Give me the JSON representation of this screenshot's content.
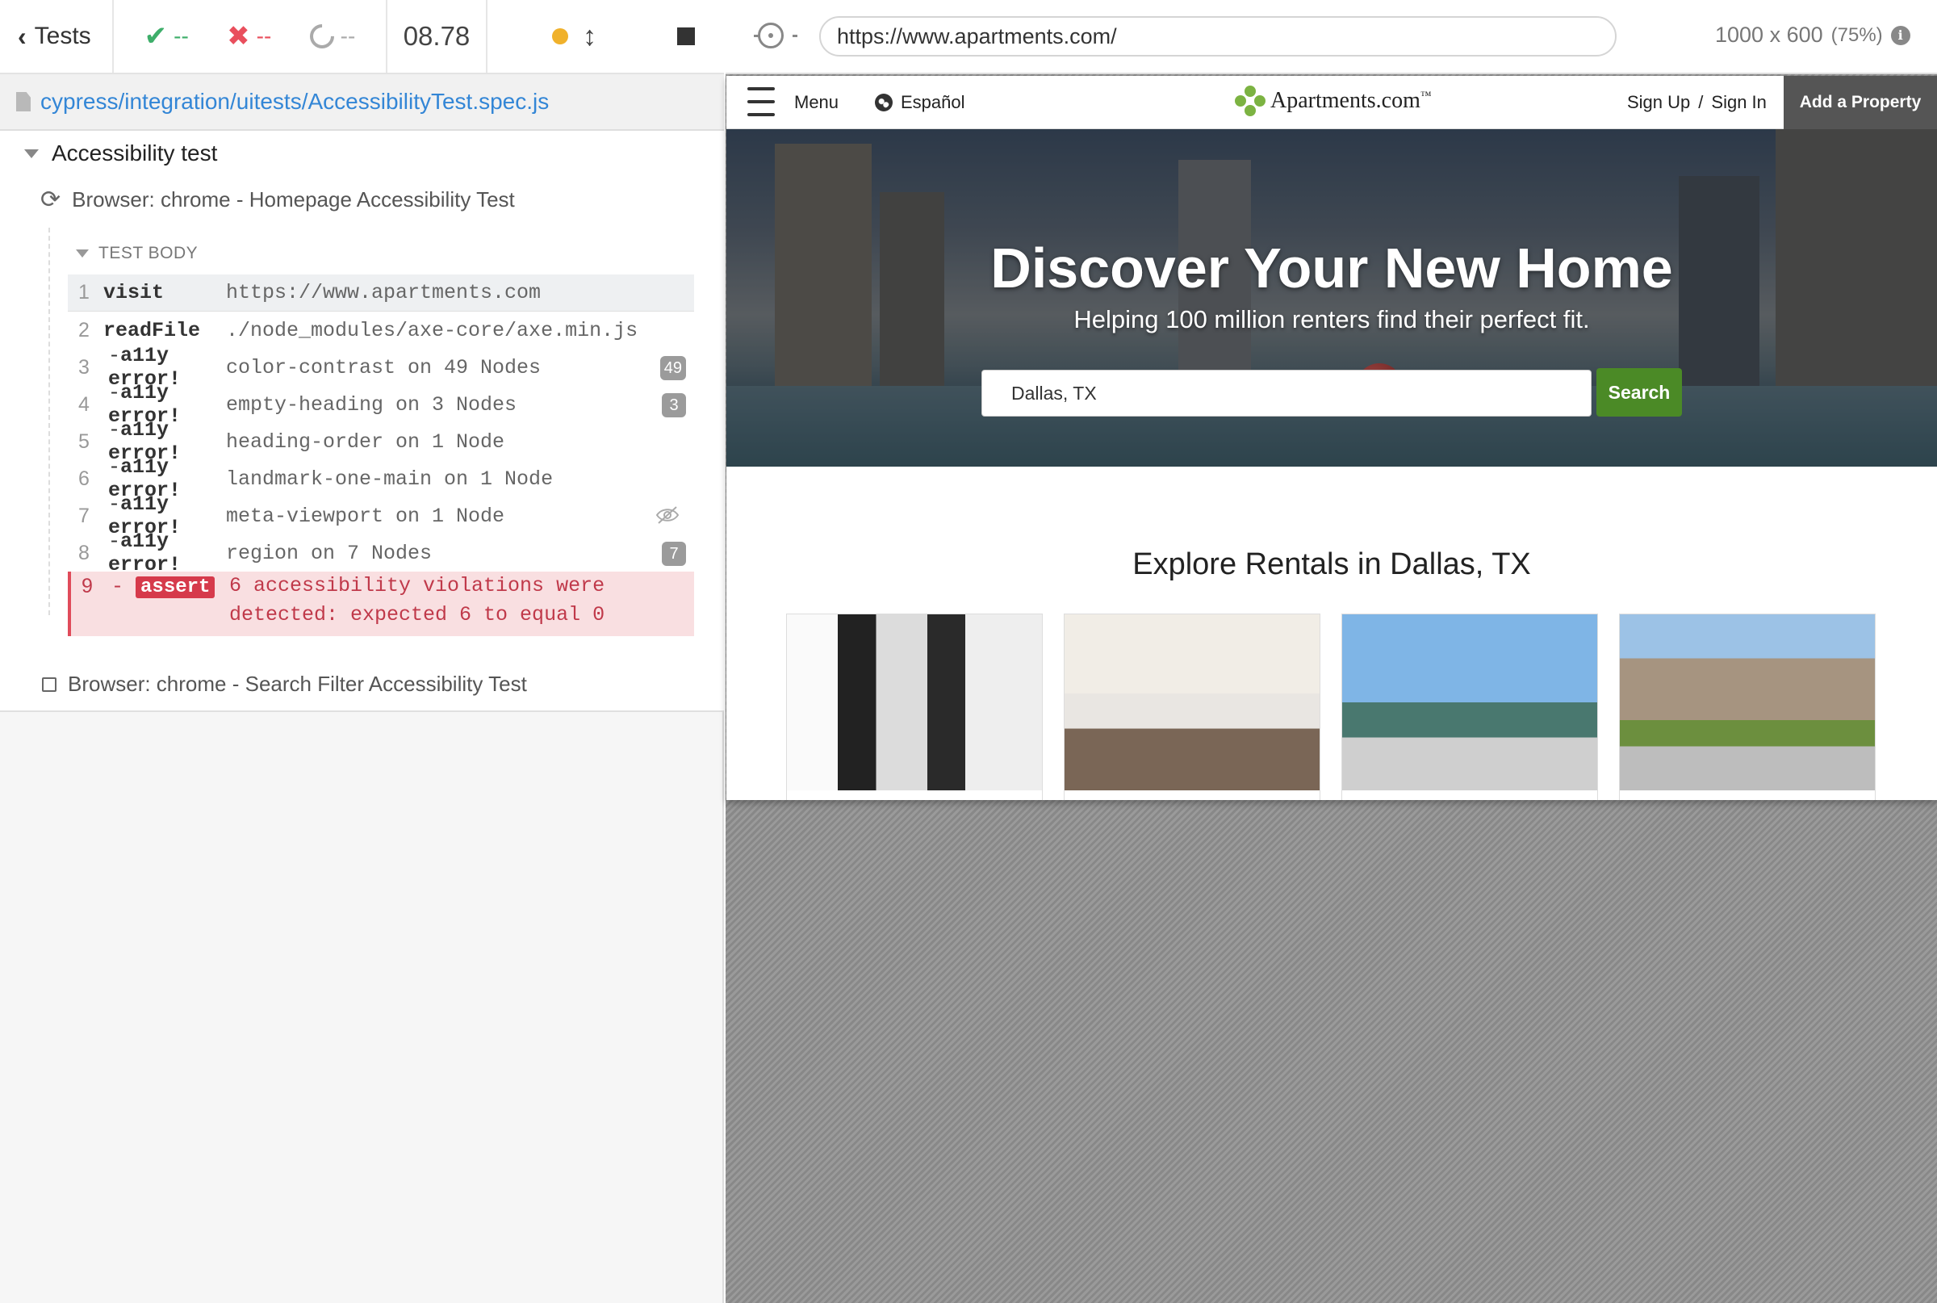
{
  "reporter": {
    "back_label": "Tests",
    "stats": {
      "passed": "--",
      "failed": "--",
      "pending": "--"
    },
    "duration": "08.78",
    "spec_path": "cypress/integration/uitests/AccessibilityTest.spec.js",
    "suite_title": "Accessibility test",
    "test1_title": "Browser: chrome - Homepage Accessibility Test",
    "test_body_label": "TEST BODY",
    "commands": [
      {
        "num": "1",
        "name": "visit",
        "msg": "https://www.apartments.com"
      },
      {
        "num": "2",
        "name": "readFile",
        "msg": "./node_modules/axe-core/axe.min.js"
      },
      {
        "num": "3",
        "name": "a11y error!",
        "msg": "color-contrast on 49 Nodes",
        "badge": "49"
      },
      {
        "num": "4",
        "name": "a11y error!",
        "msg": "empty-heading on 3 Nodes",
        "badge": "3"
      },
      {
        "num": "5",
        "name": "a11y error!",
        "msg": "heading-order on 1 Node"
      },
      {
        "num": "6",
        "name": "a11y error!",
        "msg": "landmark-one-main on 1 Node"
      },
      {
        "num": "7",
        "name": "a11y error!",
        "msg": "meta-viewport on 1 Node"
      },
      {
        "num": "8",
        "name": "a11y error!",
        "msg": "region on 7 Nodes",
        "badge": "7"
      },
      {
        "num": "9",
        "name": "assert",
        "msg_line1": "6 accessibility violations were",
        "msg_line2": "detected: expected 6 to equal 0"
      }
    ],
    "test2_title": "Browser: chrome - Search Filter Accessibility Test"
  },
  "aut": {
    "url": "https://www.apartments.com/",
    "viewport": "1000 x 600",
    "zoom": "(75%)",
    "site": {
      "menu": "Menu",
      "language": "Español",
      "logo": "Apartments.com",
      "logo_tm": "™",
      "sign_up": "Sign Up",
      "separator": "/",
      "sign_in": "Sign In",
      "add_property": "Add a Property",
      "hero_title": "Discover Your New Home",
      "hero_subtitle": "Helping 100 million renters find their perfect fit.",
      "search_value": "Dallas, TX",
      "search_button": "Search",
      "explore_title": "Explore Rentals in Dallas, TX"
    }
  },
  "colors": {
    "pass": "#3eae6a",
    "fail": "#e94f5d",
    "link": "#3386d6",
    "search_button": "#4b8a26",
    "assert_bg": "#f9dfe1"
  },
  "icons": [
    "chevron-left-icon",
    "check-icon",
    "x-icon",
    "pending-spinner-icon",
    "running-dot-icon",
    "scroll-toggle-icon",
    "stop-icon",
    "file-icon",
    "refresh-icon",
    "eye-off-icon",
    "target-icon",
    "info-icon",
    "hamburger-icon",
    "globe-icon"
  ]
}
